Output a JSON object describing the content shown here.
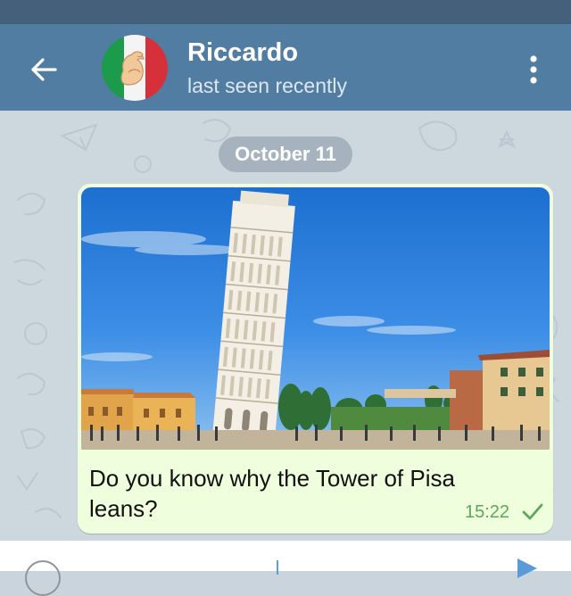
{
  "header": {
    "contact_name": "Riccardo",
    "contact_status": "last seen recently",
    "back_icon": "arrow-left-icon",
    "menu_icon": "more-vertical-icon",
    "bar_color": "#527da3",
    "status_bar_color": "#44607a"
  },
  "chat": {
    "date_label": "October 11",
    "message": {
      "caption": "Do you know why the Tower of Pisa leans?",
      "time": "15:22",
      "status_icon": "check-icon",
      "bubble_color": "#effedd",
      "time_color": "#5ea75a"
    }
  },
  "composer": {
    "emoji_icon": "emoji-icon",
    "send_icon": "send-icon",
    "accent_color": "#5a9ad6"
  }
}
